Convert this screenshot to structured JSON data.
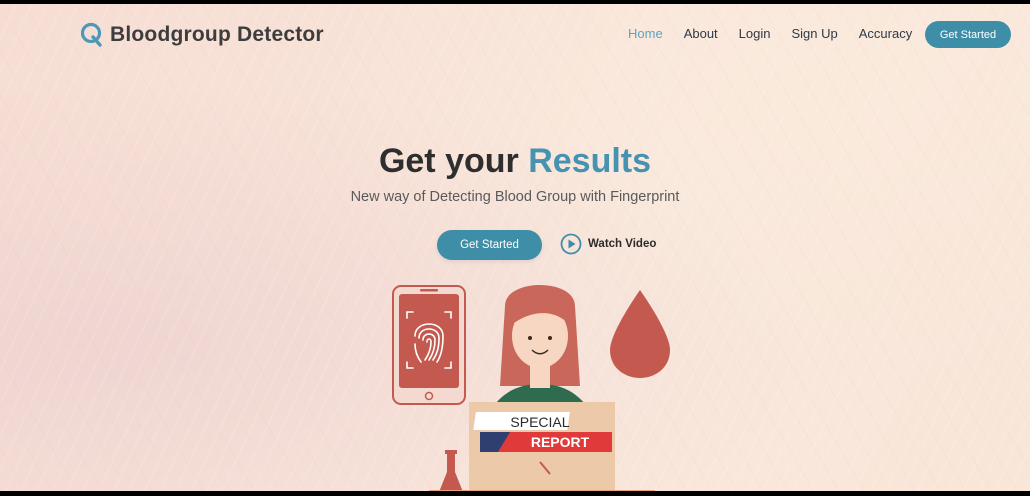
{
  "header": {
    "brand": "Bloodgroup Detector",
    "nav": [
      "Home",
      "About",
      "Login",
      "Sign Up",
      "Accuracy"
    ],
    "active_nav": "Home",
    "cta_label": "Get Started"
  },
  "hero": {
    "title_prefix": "Get your",
    "title_accent": "Results",
    "subtitle": "New way of Detecting Blood Group with Fingerprint",
    "cta_label": "Get Started",
    "watch_label": "Watch Video"
  },
  "illustration": {
    "banner_top": "SPECIAL",
    "banner_bottom": "REPORT"
  },
  "colors": {
    "accent": "#3e8ea8",
    "accent_text": "#4593b0",
    "blood": "#c45a4f"
  },
  "icons": [
    "logo-q-icon",
    "play-icon",
    "fingerprint-icon",
    "blood-drop-icon"
  ]
}
